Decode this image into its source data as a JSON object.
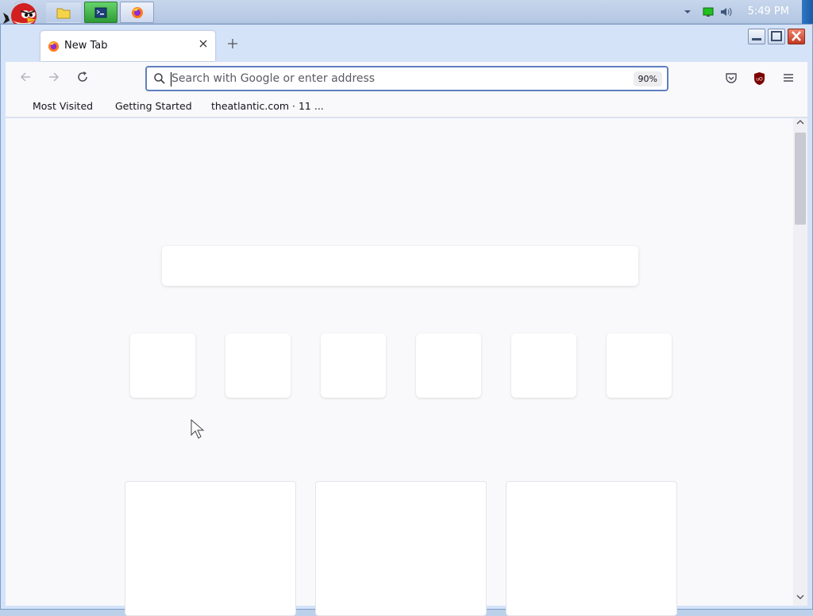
{
  "taskbar": {
    "clock": "5:49 PM",
    "start_icon": "angry-bird-icon",
    "buttons": [
      {
        "name": "files",
        "icon": "folder-icon"
      },
      {
        "name": "terminal",
        "icon": "terminal-icon"
      },
      {
        "name": "firefox",
        "icon": "firefox-icon"
      }
    ],
    "tray": [
      "chevron-down-icon",
      "network-icon",
      "volume-icon"
    ]
  },
  "browser": {
    "tab": {
      "title": "New Tab",
      "icon": "firefox-icon"
    },
    "urlbar": {
      "placeholder": "Search with Google or enter address",
      "zoom": "90%"
    },
    "bookmarks": [
      "Most Visited",
      "Getting Started",
      "theatlantic.com · 11 ..."
    ],
    "toolbar_icons": [
      "pocket-icon",
      "ublock-origin-icon",
      "menu-icon"
    ]
  },
  "colors": {
    "accent": "#5f7fbf",
    "taskbar": "#b3c6e2",
    "content_bg": "#f9f9fb"
  }
}
